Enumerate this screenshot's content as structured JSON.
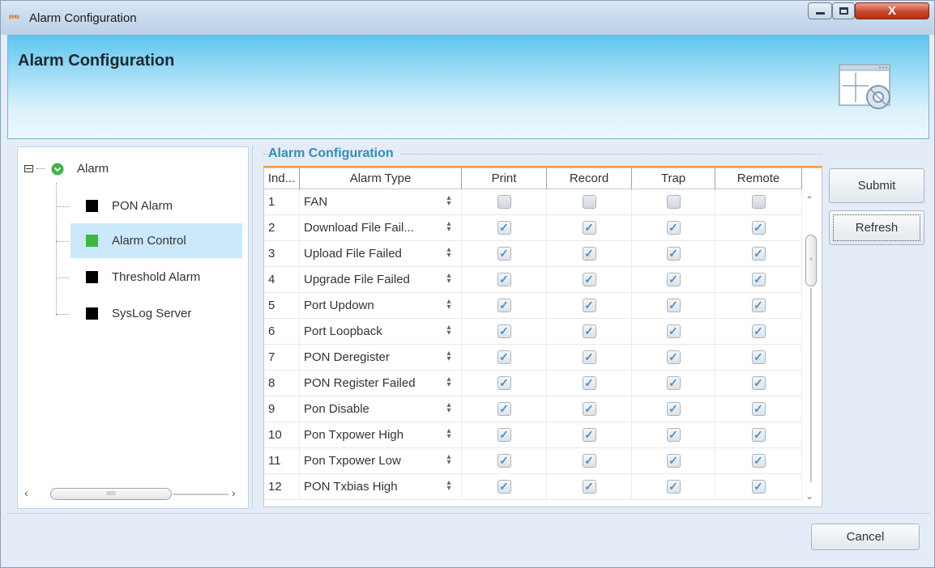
{
  "window": {
    "logo": "EMS",
    "title": "Alarm Configuration",
    "close_glyph": "X"
  },
  "banner": {
    "title": "Alarm Configuration",
    "icon": "config-dialog-icon"
  },
  "tree": {
    "root": {
      "label": "Alarm",
      "icon": "green-chevron-down-icon"
    },
    "items": [
      {
        "label": "PON Alarm",
        "color": "#000000"
      },
      {
        "label": "Alarm Control",
        "color": "#3cb83c"
      },
      {
        "label": "Threshold Alarm",
        "color": "#000000"
      },
      {
        "label": "SysLog Server",
        "color": "#000000"
      }
    ],
    "selected": "Alarm Control"
  },
  "table": {
    "section_title": "Alarm Configuration",
    "columns": [
      "Ind...",
      "Alarm Type",
      "Print",
      "Record",
      "Trap",
      "Remote"
    ],
    "rows": [
      {
        "index": "1",
        "type": "FAN",
        "print": false,
        "record": false,
        "trap": false,
        "remote": false
      },
      {
        "index": "2",
        "type": "Download File Fail...",
        "print": true,
        "record": true,
        "trap": true,
        "remote": true
      },
      {
        "index": "3",
        "type": "Upload File Failed",
        "print": true,
        "record": true,
        "trap": true,
        "remote": true
      },
      {
        "index": "4",
        "type": "Upgrade File Failed",
        "print": true,
        "record": true,
        "trap": true,
        "remote": true
      },
      {
        "index": "5",
        "type": "Port Updown",
        "print": true,
        "record": true,
        "trap": true,
        "remote": true
      },
      {
        "index": "6",
        "type": "Port Loopback",
        "print": true,
        "record": true,
        "trap": true,
        "remote": true
      },
      {
        "index": "7",
        "type": "PON Deregister",
        "print": true,
        "record": true,
        "trap": true,
        "remote": true
      },
      {
        "index": "8",
        "type": "PON Register Failed",
        "print": true,
        "record": true,
        "trap": true,
        "remote": true
      },
      {
        "index": "9",
        "type": "Pon Disable",
        "print": true,
        "record": true,
        "trap": true,
        "remote": true
      },
      {
        "index": "10",
        "type": "Pon Txpower High",
        "print": true,
        "record": true,
        "trap": true,
        "remote": true
      },
      {
        "index": "11",
        "type": "Pon Txpower Low",
        "print": true,
        "record": true,
        "trap": true,
        "remote": true
      },
      {
        "index": "12",
        "type": "PON Txbias High",
        "print": true,
        "record": true,
        "trap": true,
        "remote": true
      }
    ]
  },
  "buttons": {
    "submit": "Submit",
    "refresh": "Refresh",
    "cancel": "Cancel"
  },
  "colors": {
    "accent": "#2f8fb8",
    "banner": "#5cc6ef",
    "selection": "#cce8fb"
  }
}
